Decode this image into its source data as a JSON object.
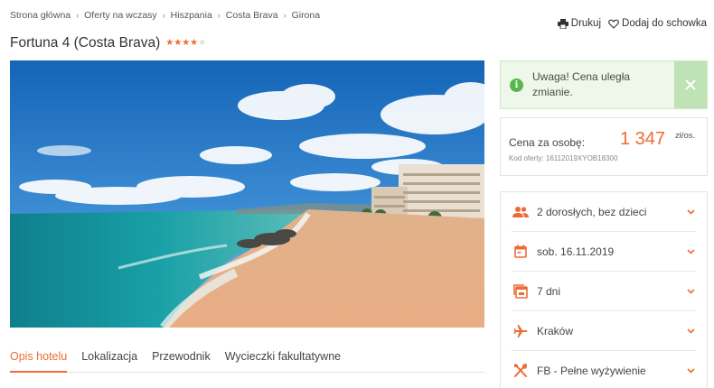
{
  "breadcrumb": [
    "Strona główna",
    "Oferty na wczasy",
    "Hiszpania",
    "Costa Brava",
    "Girona"
  ],
  "actions": {
    "print": "Drukuj",
    "bookmark": "Dodaj do schowka"
  },
  "hotel": {
    "title": "Fortuna 4 (Costa Brava)",
    "stars_filled": 4,
    "stars_total": 5
  },
  "hero_image": {
    "icon": "beach-photo"
  },
  "tabs": [
    {
      "label": "Opis hotelu",
      "active": true
    },
    {
      "label": "Lokalizacja",
      "active": false
    },
    {
      "label": "Przewodnik",
      "active": false
    },
    {
      "label": "Wycieczki fakultatywne",
      "active": false
    }
  ],
  "alert": {
    "text": "Uwaga! Cena uległa zmianie."
  },
  "price": {
    "label": "Cena za osobę:",
    "value": "1 347",
    "unit": "zł/os.",
    "offer_code": "Kod oferty: 16112019XYOB18300"
  },
  "options": [
    {
      "icon": "people-icon",
      "label": "2 dorosłych, bez dzieci"
    },
    {
      "icon": "calendar-icon",
      "label": "sob. 16.11.2019"
    },
    {
      "icon": "duration-icon",
      "label": "7 dni"
    },
    {
      "icon": "plane-icon",
      "label": "Kraków"
    },
    {
      "icon": "food-icon",
      "label": "FB - Pełne wyżywienie"
    }
  ],
  "colors": {
    "accent": "#ee6b35",
    "success": "#59b64a",
    "success_bg": "#eef8ea",
    "border": "#e3e3e3",
    "star": "#ee6b35"
  }
}
